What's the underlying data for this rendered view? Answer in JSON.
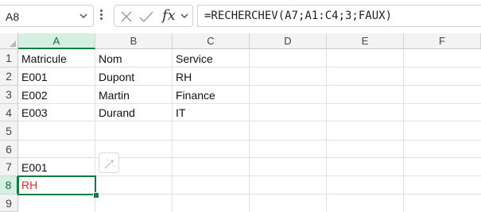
{
  "name_box": {
    "value": "A8"
  },
  "formula_bar": {
    "formula": "=RECHERCHEV(A7;A1:C4;3;FAUX)",
    "fx_label": "fx"
  },
  "columns": [
    "A",
    "B",
    "C",
    "D",
    "E",
    "F"
  ],
  "rows": [
    "1",
    "2",
    "3",
    "4",
    "5",
    "6",
    "7",
    "8",
    "9"
  ],
  "cells": {
    "A1": "Matricule",
    "B1": "Nom",
    "C1": "Service",
    "A2": "E001",
    "B2": "Dupont",
    "C2": "RH",
    "A3": "E002",
    "B3": "Martin",
    "C3": "Finance",
    "A4": "E003",
    "B4": "Durand",
    "C4": "IT",
    "A7": "E001",
    "A8": "RH"
  },
  "active_cell": "A8",
  "colors": {
    "accent": "#107c41",
    "result_text": "#e0282a",
    "header_bg": "#f3f3f3",
    "selected_header_bg": "#d3f0e0"
  },
  "icons": {
    "name_box_dropdown": "chevron-down-icon",
    "more": "more-vertical-icon",
    "cancel": "close-icon",
    "enter": "check-icon",
    "insert_function": "fx-icon",
    "formula_expand": "chevron-down-icon",
    "quick_analysis": "sparkle-icon"
  }
}
